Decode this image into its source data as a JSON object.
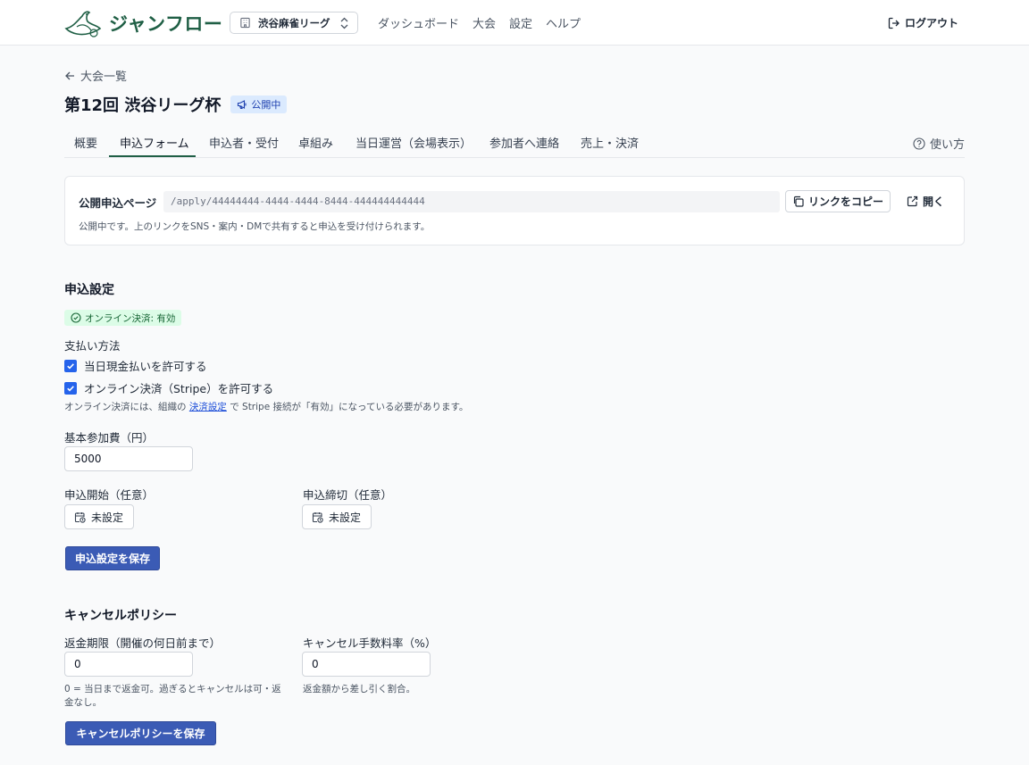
{
  "header": {
    "app_name": "ジャンフロー",
    "org_name": "渋谷麻雀リーグ",
    "nav": [
      "ダッシュボード",
      "大会",
      "設定",
      "ヘルプ"
    ],
    "logout_label": "ログアウト"
  },
  "page": {
    "back_label": "大会一覧",
    "title": "第12回 渋谷リーグ杯",
    "status_badge": "公開中"
  },
  "tabs": {
    "items": [
      "概要",
      "申込フォーム",
      "申込者・受付",
      "卓組み",
      "当日運営（会場表示）",
      "参加者へ連絡",
      "売上・決済"
    ],
    "active": "申込フォーム",
    "help_label": "使い方"
  },
  "public_page": {
    "label": "公開申込ページ",
    "url": "/apply/44444444-4444-4444-8444-444444444444",
    "copy_label": "リンクをコピー",
    "open_label": "開く",
    "note": "公開中です。上のリンクをSNS・案内・DMで共有すると申込を受け付けられます。"
  },
  "entry_settings": {
    "title": "申込設定",
    "online_badge": "オンライン決済: 有効",
    "payment_label": "支払い方法",
    "cash_option": "当日現金払いを許可する",
    "cash_checked": true,
    "online_option": "オンライン決済（Stripe）を許可する",
    "online_checked": true,
    "hint_prefix": "オンライン決済には、組織の",
    "hint_link": "決済設定",
    "hint_suffix": "で Stripe 接続が「有効」になっている必要があります。",
    "fee_label": "基本参加費（円）",
    "fee_value": "5000",
    "start_label": "申込開始（任意）",
    "start_value": "未設定",
    "end_label": "申込締切（任意）",
    "end_value": "未設定",
    "save_label": "申込設定を保存"
  },
  "cancel_policy": {
    "title": "キャンセルポリシー",
    "refund_label": "返金期限（開催の何日前まで）",
    "refund_value": "0",
    "refund_hint": "0 = 当日まで返金可。過ぎるとキャンセルは可・返金なし。",
    "fee_label": "キャンセル手数料率（%）",
    "fee_value": "0",
    "fee_hint": "返金額から差し引く割合。",
    "save_label": "キャンセルポリシーを保存"
  },
  "colors": {
    "brand": "#1f5f45",
    "primary_button": "#3b5bb5",
    "badge_public_bg": "#dbeafe",
    "badge_online_bg": "#dcfce7"
  }
}
